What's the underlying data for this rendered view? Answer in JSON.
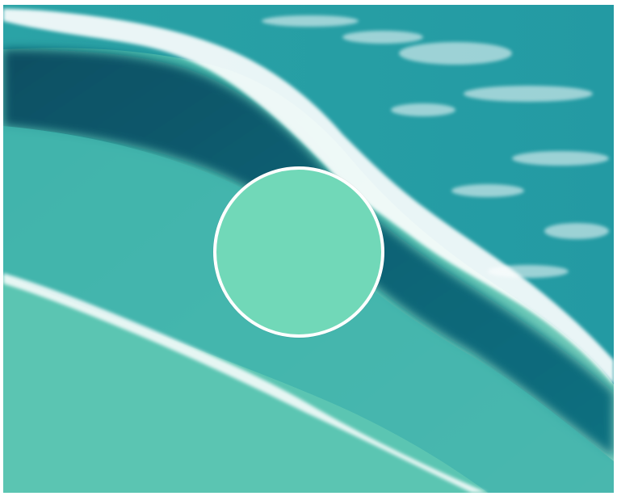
{
  "scene": {
    "icon": "ocean-waves-aerial-photo"
  },
  "color_swatch": {
    "fill_color": "#71d8b8",
    "border_color": "#ffffff",
    "icon": "color-swatch-circle"
  },
  "palette": {
    "deep_water": "#0a5d6e",
    "mid_water": "#1f9aa3",
    "shallow_water": "#4fc2b2",
    "foam": "#ffffff"
  }
}
